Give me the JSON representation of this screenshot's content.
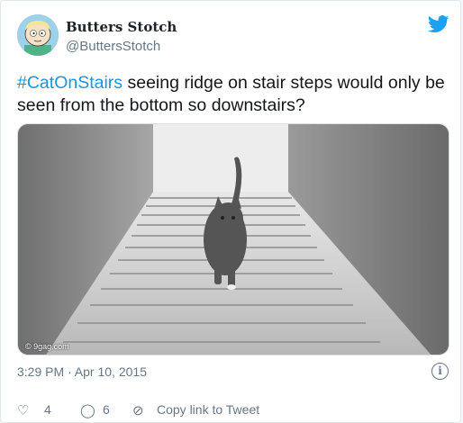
{
  "author": {
    "name": "Butters Stotch",
    "handle": "@ButtersStotch"
  },
  "tweet": {
    "hashtag": "#CatOnStairs",
    "text": " seeing ridge on stair steps would only be seen from the bottom so downstairs?"
  },
  "media": {
    "watermark": "© 9gag.com"
  },
  "meta": {
    "timestamp": "3:29 PM · Apr 10, 2015"
  },
  "actions": {
    "like_count": "4",
    "reply_count": "6",
    "copy_link_label": "Copy link to Tweet"
  },
  "colors": {
    "link": "#1b95e0",
    "secondary_text": "#657786",
    "twitter_blue": "#1da1f2"
  },
  "icons": [
    "twitter-bird-icon",
    "info-icon",
    "heart-icon",
    "reply-icon",
    "link-icon"
  ]
}
